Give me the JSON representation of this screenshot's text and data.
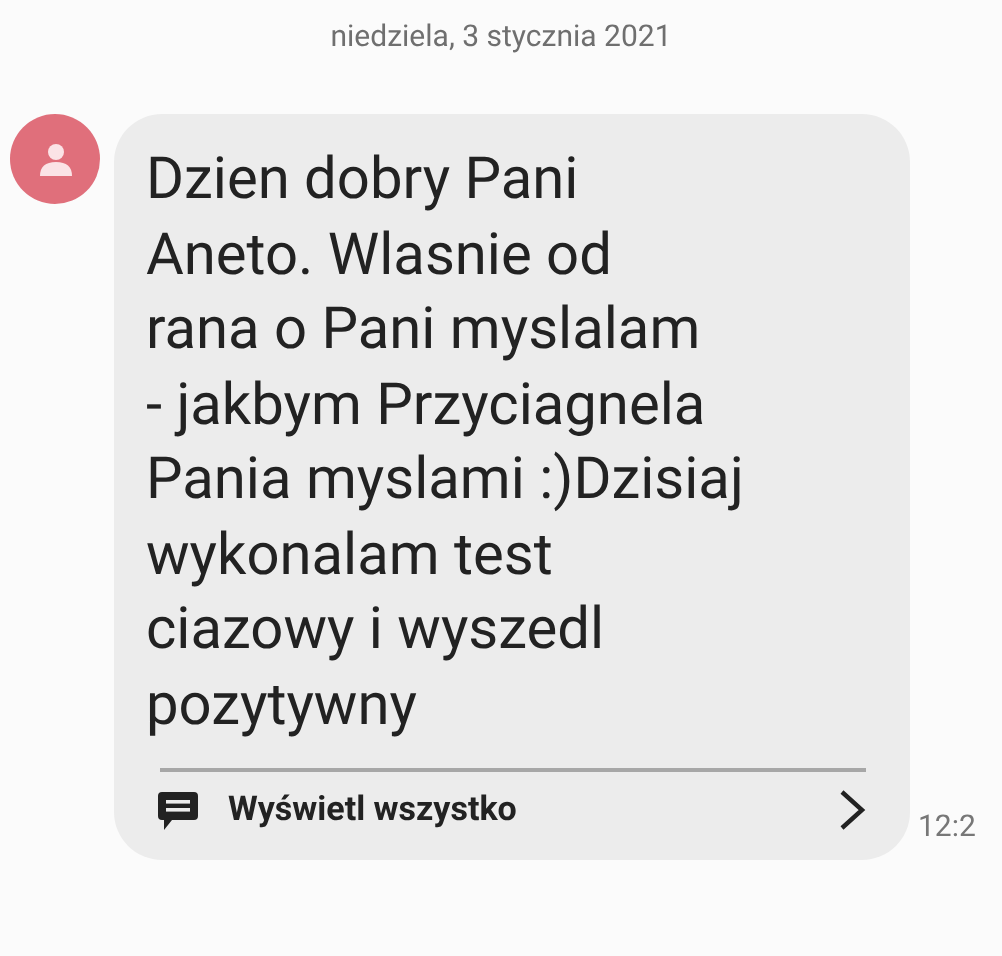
{
  "date_header": "niedziela, 3 stycznia 2021",
  "message": {
    "text": "Dzien dobry Pani\nAneto. Wlasnie od\nrana o Pani myslalam\n- jakbym Przyciagnela\nPania myslami :)Dzisiaj\nwykonalam test\nciazowy i wyszedl\npozytywny",
    "view_all": "Wyświetl wszystko",
    "time": "12:2"
  }
}
